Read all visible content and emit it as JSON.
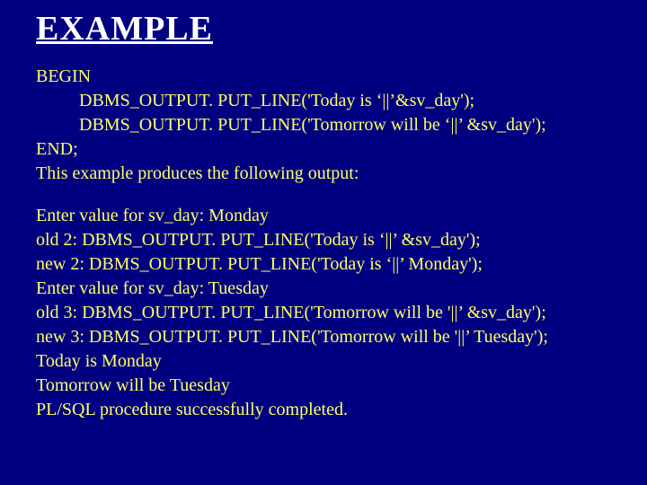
{
  "title": "EXAMPLE",
  "code": {
    "l1": "BEGIN",
    "l2": "DBMS_OUTPUT. PUT_LINE('Today is ‘||’&sv_day');",
    "l3": "DBMS_OUTPUT. PUT_LINE('Tomorrow will be ‘||’ &sv_day');",
    "l4": "END;",
    "l5": "This example produces the following output:"
  },
  "output": {
    "o1": "Enter value for sv_day: Monday",
    "o2": "old 2: DBMS_OUTPUT. PUT_LINE('Today is ‘||’ &sv_day');",
    "o3": "new 2: DBMS_OUTPUT. PUT_LINE('Today is ‘||’ Monday');",
    "o4": "Enter value for sv_day: Tuesday",
    "o5": "old 3: DBMS_OUTPUT. PUT_LINE('Tomorrow will be '||’ &sv_day');",
    "o6": "new 3: DBMS_OUTPUT. PUT_LINE('Tomorrow will be '||’ Tuesday');",
    "o7": "Today is Monday",
    "o8": "Tomorrow will be Tuesday",
    "o9": "PL/SQL procedure successfully completed."
  }
}
